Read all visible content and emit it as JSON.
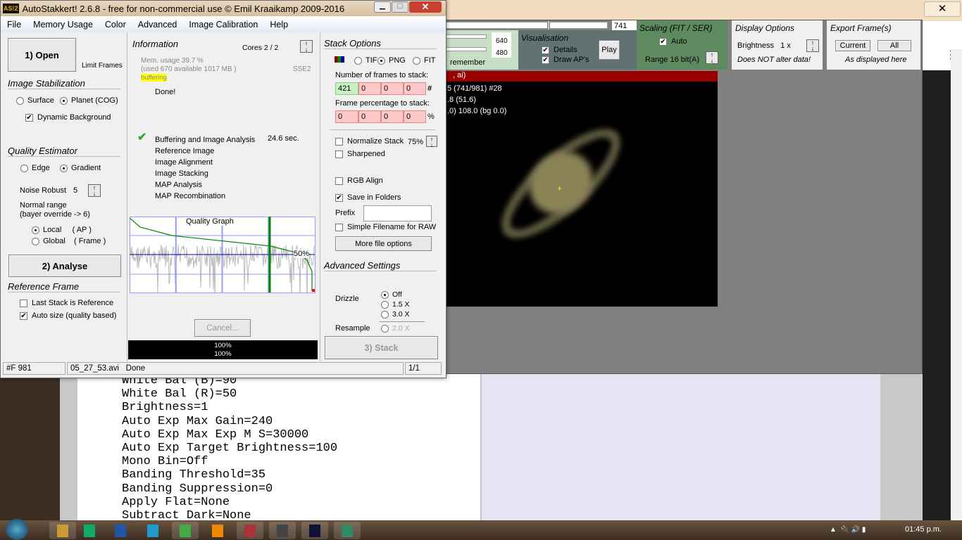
{
  "window": {
    "title": "AutoStakkert! 2.6.8 - free for non-commercial use © Emil Kraaikamp 2009-2016",
    "logo": "AS!2"
  },
  "menu": [
    "File",
    "Memory Usage",
    "Color",
    "Advanced",
    "Image Calibration",
    "Help"
  ],
  "left": {
    "open": "1) Open",
    "limit_frames": "Limit Frames",
    "stab_title": "Image Stabilization",
    "surface": "Surface",
    "planet": "Planet (COG)",
    "dynamic_bg": "Dynamic Background",
    "qe_title": "Quality Estimator",
    "edge": "Edge",
    "gradient": "Gradient",
    "noise_label": "Noise Robust",
    "noise_value": "5",
    "normal_range": "Normal range",
    "bayer": "(bayer override -> 6)",
    "local": "Local",
    "local_ap": "( AP )",
    "global": "Global",
    "global_frame": "( Frame )",
    "analyse": "2) Analyse",
    "ref_title": "Reference Frame",
    "last_stack": "Last Stack is Reference",
    "auto_size": "Auto size (quality based)"
  },
  "info": {
    "title": "Information",
    "cores": "Cores 2 / 2",
    "mem": "Mem. usage 39.7 %",
    "used": "(used 670 available 1017 MB )",
    "sse": "SSE2",
    "buffering": "buffering",
    "done": "Done!",
    "steps": [
      "Buffering and Image Analysis",
      "Reference Image",
      "Image Alignment",
      "Image Stacking",
      "MAP Analysis",
      "MAP Recombination"
    ],
    "time": "24.6 sec.",
    "graph_title": "Quality Graph",
    "graph_pct": "50%",
    "cancel": "Cancel...",
    "progress1": "100%",
    "progress2": "100%"
  },
  "stack": {
    "title": "Stack Options",
    "tif": "TIF",
    "png": "PNG",
    "fit": "FIT",
    "frames_label": "Number of frames to stack:",
    "frames": [
      "421",
      "0",
      "0",
      "0"
    ],
    "hash": "#",
    "pct_label": "Frame percentage to stack:",
    "pcts": [
      "0",
      "0",
      "0",
      "0"
    ],
    "pct_sym": "%",
    "normalize": "Normalize Stack",
    "normalize_pct": "75%",
    "sharpened": "Sharpened",
    "rgb_align": "RGB Align",
    "save_folders": "Save in Folders",
    "prefix": "Prefix",
    "prefix_value": "",
    "simple_fn": "Simple Filename for RAW",
    "more": "More file options",
    "adv_title": "Advanced Settings",
    "drizzle": "Drizzle",
    "off": "Off",
    "x15": "1.5 X",
    "x30": "3.0 X",
    "resample": "Resample",
    "x20": "2.0 X",
    "stack_btn": "3) Stack"
  },
  "status": {
    "frames": "#F 981",
    "file": "05_27_53.avi",
    "state": "Done",
    "page": "1/1"
  },
  "viewer": {
    "frame": "741",
    "w": "640",
    "h": "480",
    "remember": "remember",
    "vis_title": "Visualisation",
    "details": "Details",
    "draw_aps": "Draw AP's",
    "play": "Play",
    "scaling_title": "Scaling (FIT / SER)",
    "auto": "Auto",
    "range": "Range 16 bit(A)",
    "disp_title": "Display Options",
    "brightness": "Brightness",
    "bright_val": "1 x",
    "not_alter": "Does NOT alter data!",
    "export_title": "Export Frame(s)",
    "current": "Current",
    "all": "All",
    "as_displayed": "As displayed here",
    "overlay": [
      ", ai)",
      "5 (741/981) #28",
      ".8  (51.6)",
      ".0) 108.0 (bg 0.0)"
    ]
  },
  "document": {
    "lines": [
      "White Bal (B)=90",
      "White Bal (R)=50",
      "Brightness=1",
      "Auto Exp Max Gain=240",
      "Auto Exp Max Exp M S=30000",
      "Auto Exp Target Brightness=100",
      "Mono Bin=Off",
      "Banding Threshold=35",
      "Banding Suppression=0",
      "Apply Flat=None",
      "Subtract Dark=None"
    ]
  },
  "taskbar": {
    "clock": "01:45 p.m.",
    "apps": [
      "explorer",
      "excel",
      "word",
      "ie",
      "chrome",
      "vlc",
      "winrar",
      "player",
      "autostakkert",
      "registax"
    ]
  }
}
